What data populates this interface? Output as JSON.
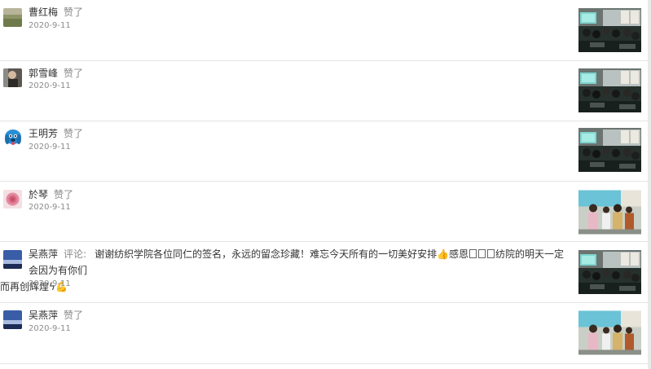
{
  "feed": {
    "items": [
      {
        "name": "曹红梅",
        "action": "赞了",
        "date": "2020-9-11"
      },
      {
        "name": "郭雪峰",
        "action": "赞了",
        "date": "2020-9-11"
      },
      {
        "name": "王明芳",
        "action": "赞了",
        "date": "2020-9-11"
      },
      {
        "name": "於琴",
        "action": "赞了",
        "date": "2020-9-11"
      },
      {
        "name": "吴燕萍",
        "action": "评论:",
        "comment_part1": "谢谢纺织学院各位同仁的签名，永远的留念珍藏！难忘今天所有的一切美好安排",
        "comment_part2": "感恩",
        "comment_part3": "纺院的明天一定会因为有你们",
        "comment_part4": "而再创辉煌",
        "date": "2020-9-11"
      },
      {
        "name": "吴燕萍",
        "action": "赞了",
        "date": "2020-9-11"
      }
    ]
  },
  "icons": {
    "avatar1": "landscape-avatar-icon",
    "avatar2": "person-avatar-icon",
    "avatar3": "cartoon-dog-avatar-icon",
    "avatar4": "rose-avatar-icon",
    "avatar5": "sky-avatar-icon",
    "thumb": "meeting-photo-icon",
    "thumb_group": "group-photo-icon",
    "emoji_like": "thumbs-up-emoji-icon",
    "emoji_lightning": "lightning-emoji-icon",
    "emoji_flex": "flexed-arm-emoji-icon"
  }
}
